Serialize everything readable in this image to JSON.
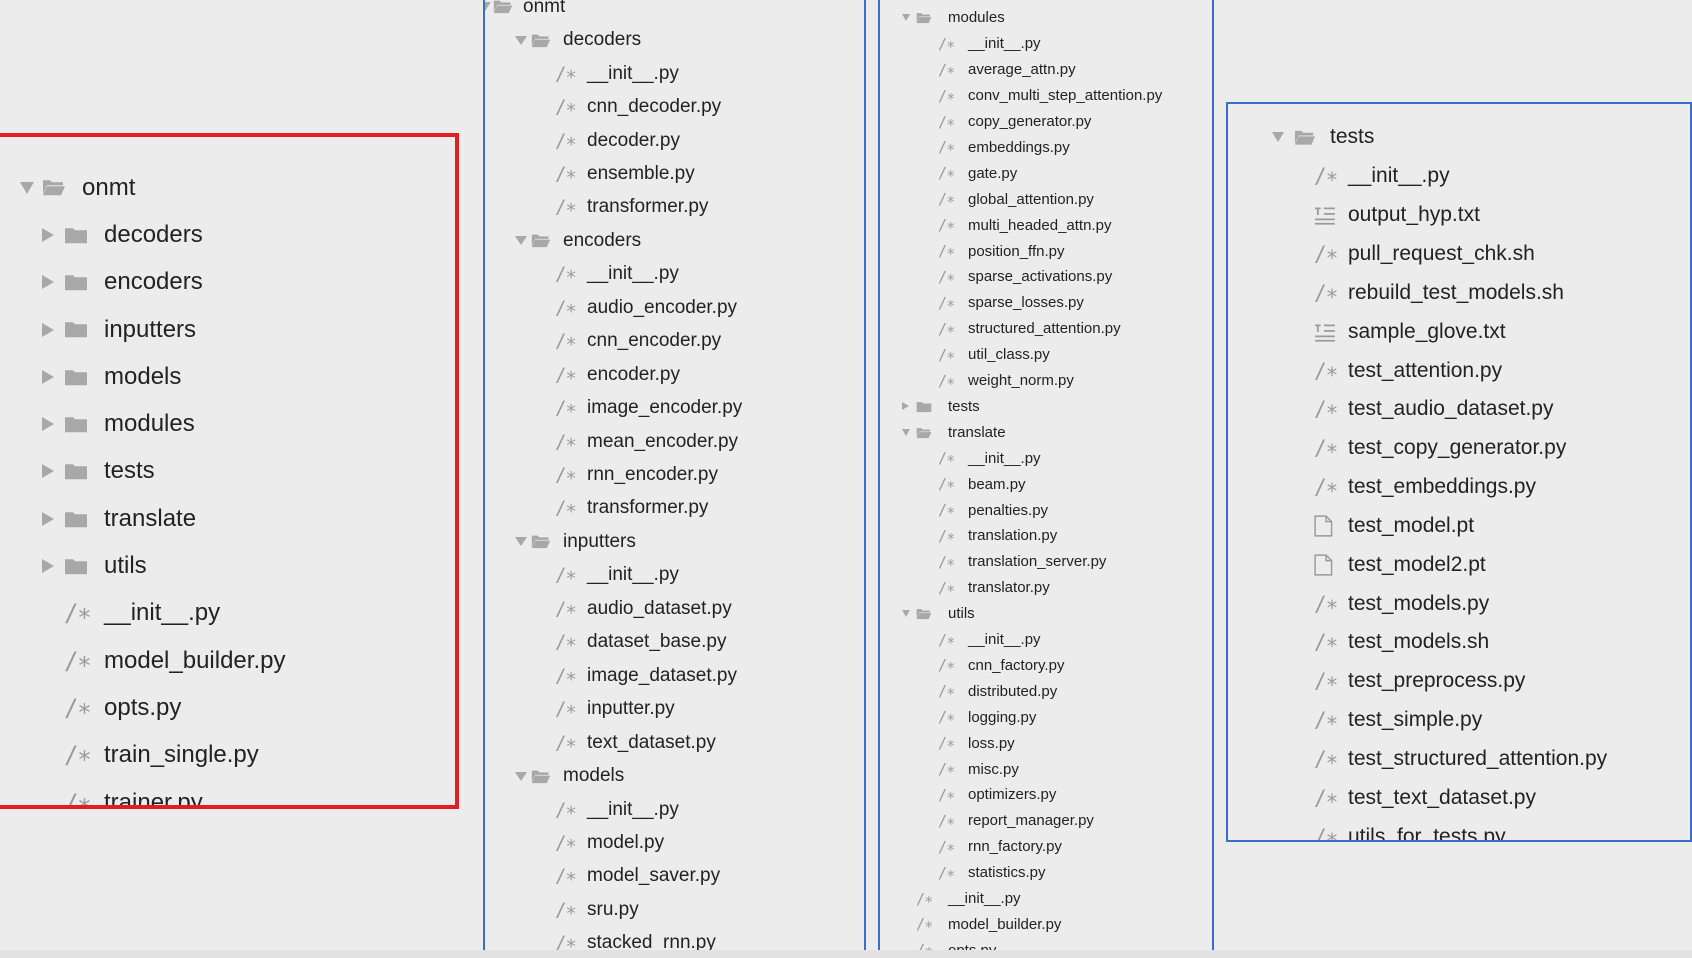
{
  "panel_large": {
    "items": [
      {
        "label": "onmt",
        "kind": "folder-open"
      },
      {
        "label": "decoders",
        "kind": "folder-closed"
      },
      {
        "label": "encoders",
        "kind": "folder-closed"
      },
      {
        "label": "inputters",
        "kind": "folder-closed"
      },
      {
        "label": "models",
        "kind": "folder-closed"
      },
      {
        "label": "modules",
        "kind": "folder-closed"
      },
      {
        "label": "tests",
        "kind": "folder-closed"
      },
      {
        "label": "translate",
        "kind": "folder-closed"
      },
      {
        "label": "utils",
        "kind": "folder-closed"
      },
      {
        "label": "__init__.py",
        "kind": "py"
      },
      {
        "label": "model_builder.py",
        "kind": "py"
      },
      {
        "label": "opts.py",
        "kind": "py"
      },
      {
        "label": "train_single.py",
        "kind": "py"
      },
      {
        "label": "trainer.py",
        "kind": "py"
      }
    ]
  },
  "panel_decoders": {
    "items": [
      {
        "label": "onmt",
        "kind": "folder-open"
      },
      {
        "label": "decoders",
        "kind": "folder-open"
      },
      {
        "label": "__init__.py",
        "kind": "py"
      },
      {
        "label": "cnn_decoder.py",
        "kind": "py"
      },
      {
        "label": "decoder.py",
        "kind": "py"
      },
      {
        "label": "ensemble.py",
        "kind": "py"
      },
      {
        "label": "transformer.py",
        "kind": "py"
      },
      {
        "label": "encoders",
        "kind": "folder-open"
      },
      {
        "label": "__init__.py",
        "kind": "py"
      },
      {
        "label": "audio_encoder.py",
        "kind": "py"
      },
      {
        "label": "cnn_encoder.py",
        "kind": "py"
      },
      {
        "label": "encoder.py",
        "kind": "py"
      },
      {
        "label": "image_encoder.py",
        "kind": "py"
      },
      {
        "label": "mean_encoder.py",
        "kind": "py"
      },
      {
        "label": "rnn_encoder.py",
        "kind": "py"
      },
      {
        "label": "transformer.py",
        "kind": "py"
      },
      {
        "label": "inputters",
        "kind": "folder-open"
      },
      {
        "label": "__init__.py",
        "kind": "py"
      },
      {
        "label": "audio_dataset.py",
        "kind": "py"
      },
      {
        "label": "dataset_base.py",
        "kind": "py"
      },
      {
        "label": "image_dataset.py",
        "kind": "py"
      },
      {
        "label": "inputter.py",
        "kind": "py"
      },
      {
        "label": "text_dataset.py",
        "kind": "py"
      },
      {
        "label": "models",
        "kind": "folder-open"
      },
      {
        "label": "__init__.py",
        "kind": "py"
      },
      {
        "label": "model.py",
        "kind": "py"
      },
      {
        "label": "model_saver.py",
        "kind": "py"
      },
      {
        "label": "sru.py",
        "kind": "py"
      },
      {
        "label": "stacked_rnn.py",
        "kind": "py"
      }
    ]
  },
  "panel_modules": {
    "items": [
      {
        "label": "modules",
        "kind": "folder-open"
      },
      {
        "label": "__init__.py",
        "kind": "py"
      },
      {
        "label": "average_attn.py",
        "kind": "py"
      },
      {
        "label": "conv_multi_step_attention.py",
        "kind": "py"
      },
      {
        "label": "copy_generator.py",
        "kind": "py"
      },
      {
        "label": "embeddings.py",
        "kind": "py"
      },
      {
        "label": "gate.py",
        "kind": "py"
      },
      {
        "label": "global_attention.py",
        "kind": "py"
      },
      {
        "label": "multi_headed_attn.py",
        "kind": "py"
      },
      {
        "label": "position_ffn.py",
        "kind": "py"
      },
      {
        "label": "sparse_activations.py",
        "kind": "py"
      },
      {
        "label": "sparse_losses.py",
        "kind": "py"
      },
      {
        "label": "structured_attention.py",
        "kind": "py"
      },
      {
        "label": "util_class.py",
        "kind": "py"
      },
      {
        "label": "weight_norm.py",
        "kind": "py"
      },
      {
        "label": "tests",
        "kind": "folder-closed"
      },
      {
        "label": "translate",
        "kind": "folder-open"
      },
      {
        "label": "__init__.py",
        "kind": "py"
      },
      {
        "label": "beam.py",
        "kind": "py"
      },
      {
        "label": "penalties.py",
        "kind": "py"
      },
      {
        "label": "translation.py",
        "kind": "py"
      },
      {
        "label": "translation_server.py",
        "kind": "py"
      },
      {
        "label": "translator.py",
        "kind": "py"
      },
      {
        "label": "utils",
        "kind": "folder-open"
      },
      {
        "label": "__init__.py",
        "kind": "py"
      },
      {
        "label": "cnn_factory.py",
        "kind": "py"
      },
      {
        "label": "distributed.py",
        "kind": "py"
      },
      {
        "label": "logging.py",
        "kind": "py"
      },
      {
        "label": "loss.py",
        "kind": "py"
      },
      {
        "label": "misc.py",
        "kind": "py"
      },
      {
        "label": "optimizers.py",
        "kind": "py"
      },
      {
        "label": "report_manager.py",
        "kind": "py"
      },
      {
        "label": "rnn_factory.py",
        "kind": "py"
      },
      {
        "label": "statistics.py",
        "kind": "py"
      },
      {
        "label": "__init__.py",
        "kind": "py"
      },
      {
        "label": "model_builder.py",
        "kind": "py"
      },
      {
        "label": "opts.py",
        "kind": "py"
      }
    ]
  },
  "panel_tests": {
    "items": [
      {
        "label": "tests",
        "kind": "folder-open"
      },
      {
        "label": "__init__.py",
        "kind": "py"
      },
      {
        "label": "output_hyp.txt",
        "kind": "txt"
      },
      {
        "label": "pull_request_chk.sh",
        "kind": "py"
      },
      {
        "label": "rebuild_test_models.sh",
        "kind": "py"
      },
      {
        "label": "sample_glove.txt",
        "kind": "txt"
      },
      {
        "label": "test_attention.py",
        "kind": "py"
      },
      {
        "label": "test_audio_dataset.py",
        "kind": "py"
      },
      {
        "label": "test_copy_generator.py",
        "kind": "py"
      },
      {
        "label": "test_embeddings.py",
        "kind": "py"
      },
      {
        "label": "test_model.pt",
        "kind": "doc"
      },
      {
        "label": "test_model2.pt",
        "kind": "doc"
      },
      {
        "label": "test_models.py",
        "kind": "py"
      },
      {
        "label": "test_models.sh",
        "kind": "py"
      },
      {
        "label": "test_preprocess.py",
        "kind": "py"
      },
      {
        "label": "test_simple.py",
        "kind": "py"
      },
      {
        "label": "test_structured_attention.py",
        "kind": "py"
      },
      {
        "label": "test_text_dataset.py",
        "kind": "py"
      },
      {
        "label": "utils_for_tests.py",
        "kind": "py"
      }
    ]
  },
  "glyphs": {
    "py": "/∗"
  },
  "colors": {
    "highlight_border": "#e02020",
    "panel_border": "#3b6ec9",
    "icon_gray": "#a8a8a8",
    "background": "#ececec"
  }
}
